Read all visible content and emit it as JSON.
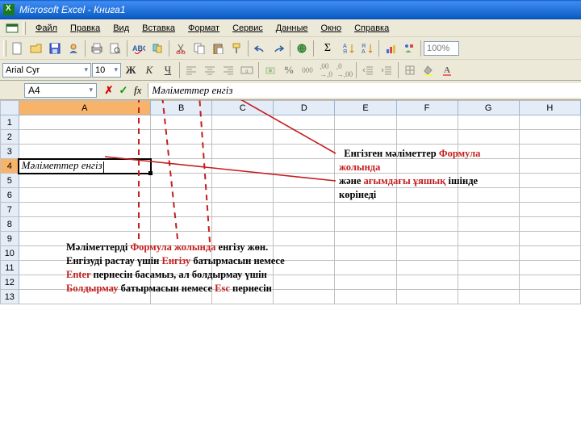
{
  "title": "Microsoft Excel - Книга1",
  "menu": {
    "file": "Файл",
    "edit": "Правка",
    "view": "Вид",
    "insert": "Вставка",
    "format": "Формат",
    "tools": "Сервис",
    "data": "Данные",
    "window": "Окно",
    "help": "Справка"
  },
  "toolbar": {
    "zoom": "100%",
    "sigma": "Σ",
    "sort_asc": "А↓Я",
    "sort_desc": "Я↓А"
  },
  "format": {
    "font": "Arial Cyr",
    "size": "10",
    "bold": "Ж",
    "italic": "К",
    "underline": "Ч",
    "currency": "%",
    "dec_inc": ",0",
    "dec_dec": "00"
  },
  "namebox": "A4",
  "fx": "fx",
  "formula_input": "Мәліметтер енгіз",
  "columns": [
    "A",
    "B",
    "C",
    "D",
    "E",
    "F",
    "G",
    "H"
  ],
  "rows": [
    "1",
    "2",
    "3",
    "4",
    "5",
    "6",
    "7",
    "8",
    "9",
    "10",
    "11",
    "12",
    "13"
  ],
  "cell_A4": "Мәліметтер енгіз",
  "anno1": {
    "p1a": "Енгізген мәліметтер ",
    "p1b": "Формула",
    "p2a": "жолында",
    "p3a": "және ",
    "p3b": "ағымдағы ұяшық",
    "p3c": " ішінде",
    "p4": "көрінеді"
  },
  "anno2": {
    "p1a": "Мәліметтерді ",
    "p1b": "Формула жолында ",
    "p1c": "енгізу жөн.",
    "p2a": "Енгізуді растау үшін ",
    "p2b": "Енгізу ",
    "p2c": "батырмасын немесе",
    "p3a": "Enter ",
    "p3b": "пернесін басамыз, ал болдырмау үшін",
    "p4a": "Болдырмау ",
    "p4b": "батырмасын немесе ",
    "p4c": "Esc ",
    "p4d": "пернесін"
  }
}
